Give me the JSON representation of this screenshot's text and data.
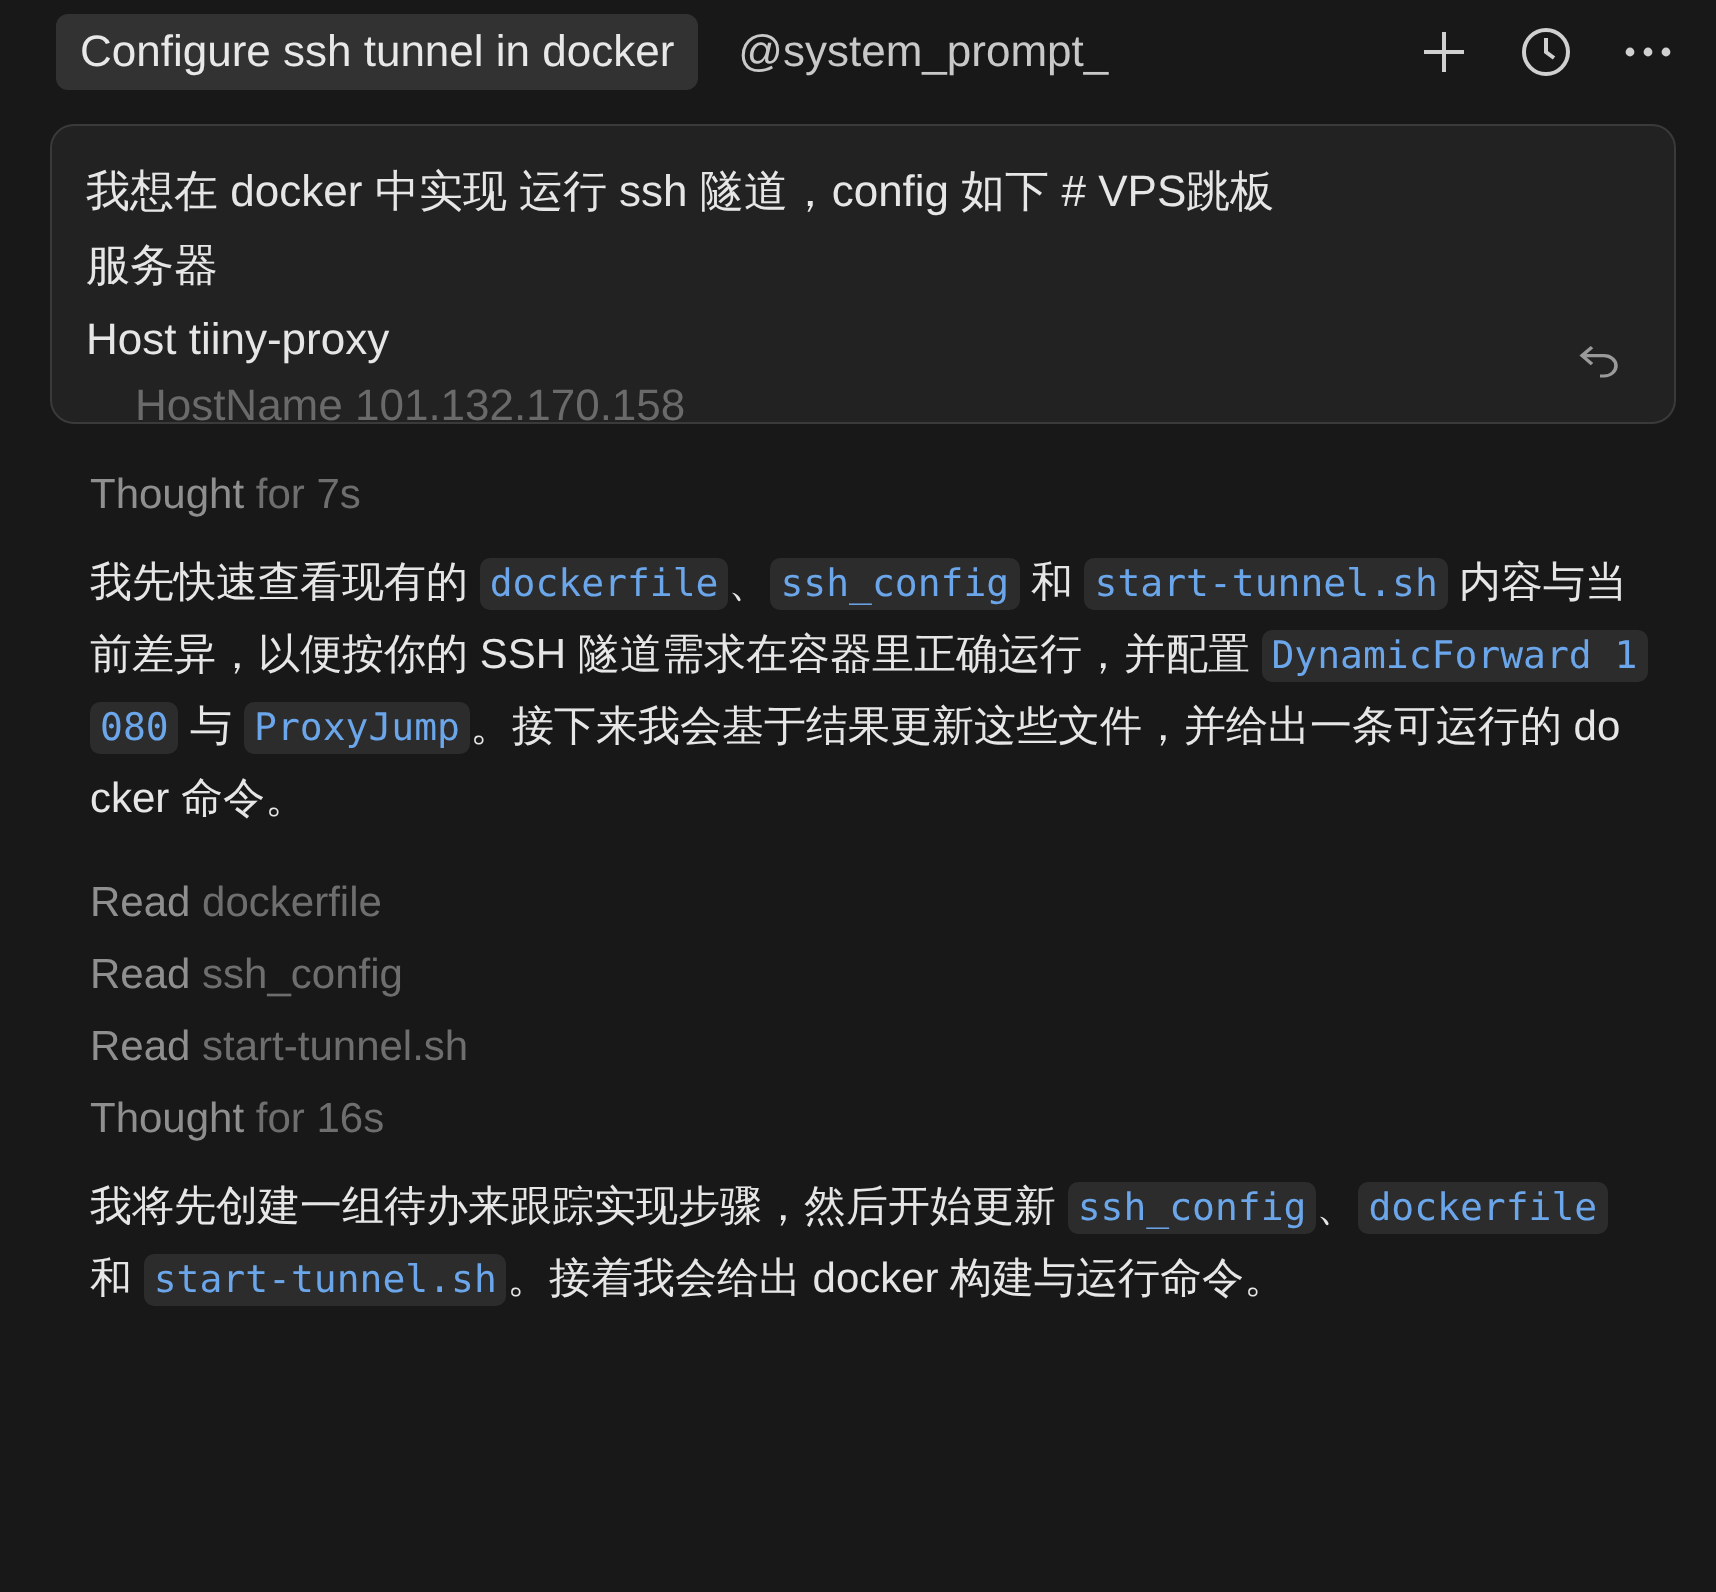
{
  "tabs": [
    {
      "label": "Configure ssh tunnel in docker",
      "selected": true
    },
    {
      "label": "@system_prompt_",
      "selected": false
    }
  ],
  "prompt": {
    "lines": [
      "我想在 docker 中实现 运行 ssh 隧道，config 如下 # VPS跳板",
      "服务器",
      "Host tiiny-proxy",
      "    HostName 101.132.170.158"
    ]
  },
  "items": [
    {
      "kind": "status",
      "verb": "Thought",
      "detail": "for 7s"
    },
    {
      "kind": "message",
      "segments": [
        {
          "text": "我先快速查看现有的 ",
          "code": false
        },
        {
          "text": "dockerfile",
          "code": true
        },
        {
          "text": "、",
          "code": false
        },
        {
          "text": "ssh_config",
          "code": true
        },
        {
          "text": " 和 ",
          "code": false
        },
        {
          "text": "start-tunnel.sh",
          "code": true
        },
        {
          "text": " 内容与当前差异，以便按你的 SSH 隧道需求在容器里正确运行，并配置 ",
          "code": false
        },
        {
          "text": "DynamicForward 1080",
          "code": true
        },
        {
          "text": " 与 ",
          "code": false
        },
        {
          "text": "ProxyJump",
          "code": true
        },
        {
          "text": "。接下来我会基于结果更新这些文件，并给出一条可运行的 docker 命令。",
          "code": false
        }
      ]
    },
    {
      "kind": "status",
      "verb": "Read",
      "detail": "dockerfile"
    },
    {
      "kind": "status",
      "verb": "Read",
      "detail": "ssh_config"
    },
    {
      "kind": "status",
      "verb": "Read",
      "detail": "start-tunnel.sh"
    },
    {
      "kind": "status",
      "verb": "Thought",
      "detail": "for 16s"
    },
    {
      "kind": "message",
      "segments": [
        {
          "text": "我将先创建一组待办来跟踪实现步骤，然后开始更新 ",
          "code": false
        },
        {
          "text": "ssh_config",
          "code": true
        },
        {
          "text": "、",
          "code": false
        },
        {
          "text": "dockerfile",
          "code": true
        },
        {
          "text": " 和 ",
          "code": false
        },
        {
          "text": "start-tunnel.sh",
          "code": true
        },
        {
          "text": "。接着我会给出 docker 构建与运行命令。",
          "code": false
        }
      ]
    }
  ]
}
